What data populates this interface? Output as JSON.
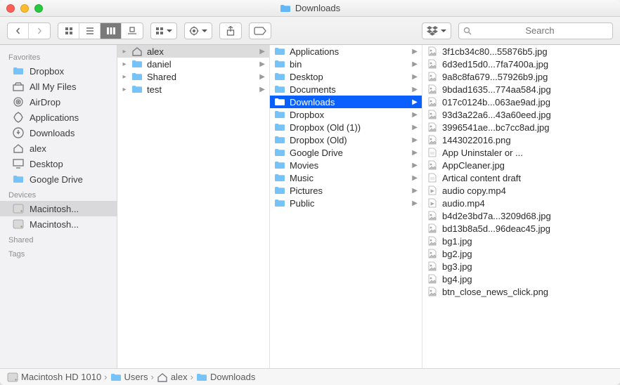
{
  "window": {
    "title": "Downloads"
  },
  "search": {
    "placeholder": "Search"
  },
  "sidebar": {
    "sections": [
      {
        "title": "Favorites",
        "items": [
          {
            "icon": "folder",
            "label": "Dropbox"
          },
          {
            "icon": "allfiles",
            "label": "All My Files"
          },
          {
            "icon": "airdrop",
            "label": "AirDrop"
          },
          {
            "icon": "apps",
            "label": "Applications"
          },
          {
            "icon": "downloads",
            "label": "Downloads"
          },
          {
            "icon": "home",
            "label": "alex"
          },
          {
            "icon": "desktop",
            "label": "Desktop"
          },
          {
            "icon": "folder",
            "label": "Google Drive"
          }
        ]
      },
      {
        "title": "Devices",
        "items": [
          {
            "icon": "disk",
            "label": "Macintosh...",
            "selected": true
          },
          {
            "icon": "disk",
            "label": "Macintosh..."
          }
        ]
      },
      {
        "title": "Shared",
        "items": []
      },
      {
        "title": "Tags",
        "items": []
      }
    ]
  },
  "columns": [
    {
      "items": [
        {
          "icon": "home",
          "label": "alex",
          "has_children": true,
          "selected": true
        },
        {
          "icon": "folder",
          "label": "daniel",
          "has_children": true
        },
        {
          "icon": "folder",
          "label": "Shared",
          "has_children": true
        },
        {
          "icon": "folder",
          "label": "test",
          "has_children": true
        }
      ]
    },
    {
      "items": [
        {
          "icon": "folder",
          "label": "Applications",
          "has_children": true
        },
        {
          "icon": "folder",
          "label": "bin",
          "has_children": true
        },
        {
          "icon": "folder",
          "label": "Desktop",
          "has_children": true
        },
        {
          "icon": "folder",
          "label": "Documents",
          "has_children": true
        },
        {
          "icon": "folder",
          "label": "Downloads",
          "has_children": true,
          "selected": true,
          "active": true
        },
        {
          "icon": "folder",
          "label": "Dropbox",
          "has_children": true
        },
        {
          "icon": "folder",
          "label": "Dropbox (Old (1))",
          "has_children": true
        },
        {
          "icon": "folder",
          "label": "Dropbox (Old)",
          "has_children": true
        },
        {
          "icon": "folder",
          "label": "Google Drive",
          "has_children": true
        },
        {
          "icon": "folder",
          "label": "Movies",
          "has_children": true
        },
        {
          "icon": "folder",
          "label": "Music",
          "has_children": true
        },
        {
          "icon": "folder",
          "label": "Pictures",
          "has_children": true
        },
        {
          "icon": "folder",
          "label": "Public",
          "has_children": true
        }
      ]
    },
    {
      "items": [
        {
          "icon": "image",
          "label": "3f1cb34c80...55876b5.jpg"
        },
        {
          "icon": "image",
          "label": "6d3ed15d0...7fa7400a.jpg"
        },
        {
          "icon": "image",
          "label": "9a8c8fa679...57926b9.jpg"
        },
        {
          "icon": "image",
          "label": "9bdad1635...774aa584.jpg"
        },
        {
          "icon": "image",
          "label": "017c0124b...063ae9ad.jpg"
        },
        {
          "icon": "image",
          "label": "93d3a22a6...43a60eed.jpg"
        },
        {
          "icon": "image",
          "label": "3996541ae...bc7cc8ad.jpg"
        },
        {
          "icon": "image",
          "label": "1443022016.png"
        },
        {
          "icon": "file",
          "label": "App Uninstaler or ..."
        },
        {
          "icon": "image",
          "label": "AppCleaner.jpg"
        },
        {
          "icon": "file",
          "label": "Artical content draft"
        },
        {
          "icon": "video",
          "label": "audio copy.mp4"
        },
        {
          "icon": "video",
          "label": "audio.mp4"
        },
        {
          "icon": "image",
          "label": "b4d2e3bd7a...3209d68.jpg"
        },
        {
          "icon": "image",
          "label": "bd13b8a5d...96deac45.jpg"
        },
        {
          "icon": "image",
          "label": "bg1.jpg"
        },
        {
          "icon": "image",
          "label": "bg2.jpg"
        },
        {
          "icon": "image",
          "label": "bg3.jpg"
        },
        {
          "icon": "image",
          "label": "bg4.jpg"
        },
        {
          "icon": "image",
          "label": "btn_close_news_click.png"
        }
      ]
    }
  ],
  "path": [
    {
      "icon": "disk",
      "label": "Macintosh HD 1010"
    },
    {
      "icon": "folder",
      "label": "Users"
    },
    {
      "icon": "home",
      "label": "alex"
    },
    {
      "icon": "folder",
      "label": "Downloads"
    }
  ]
}
